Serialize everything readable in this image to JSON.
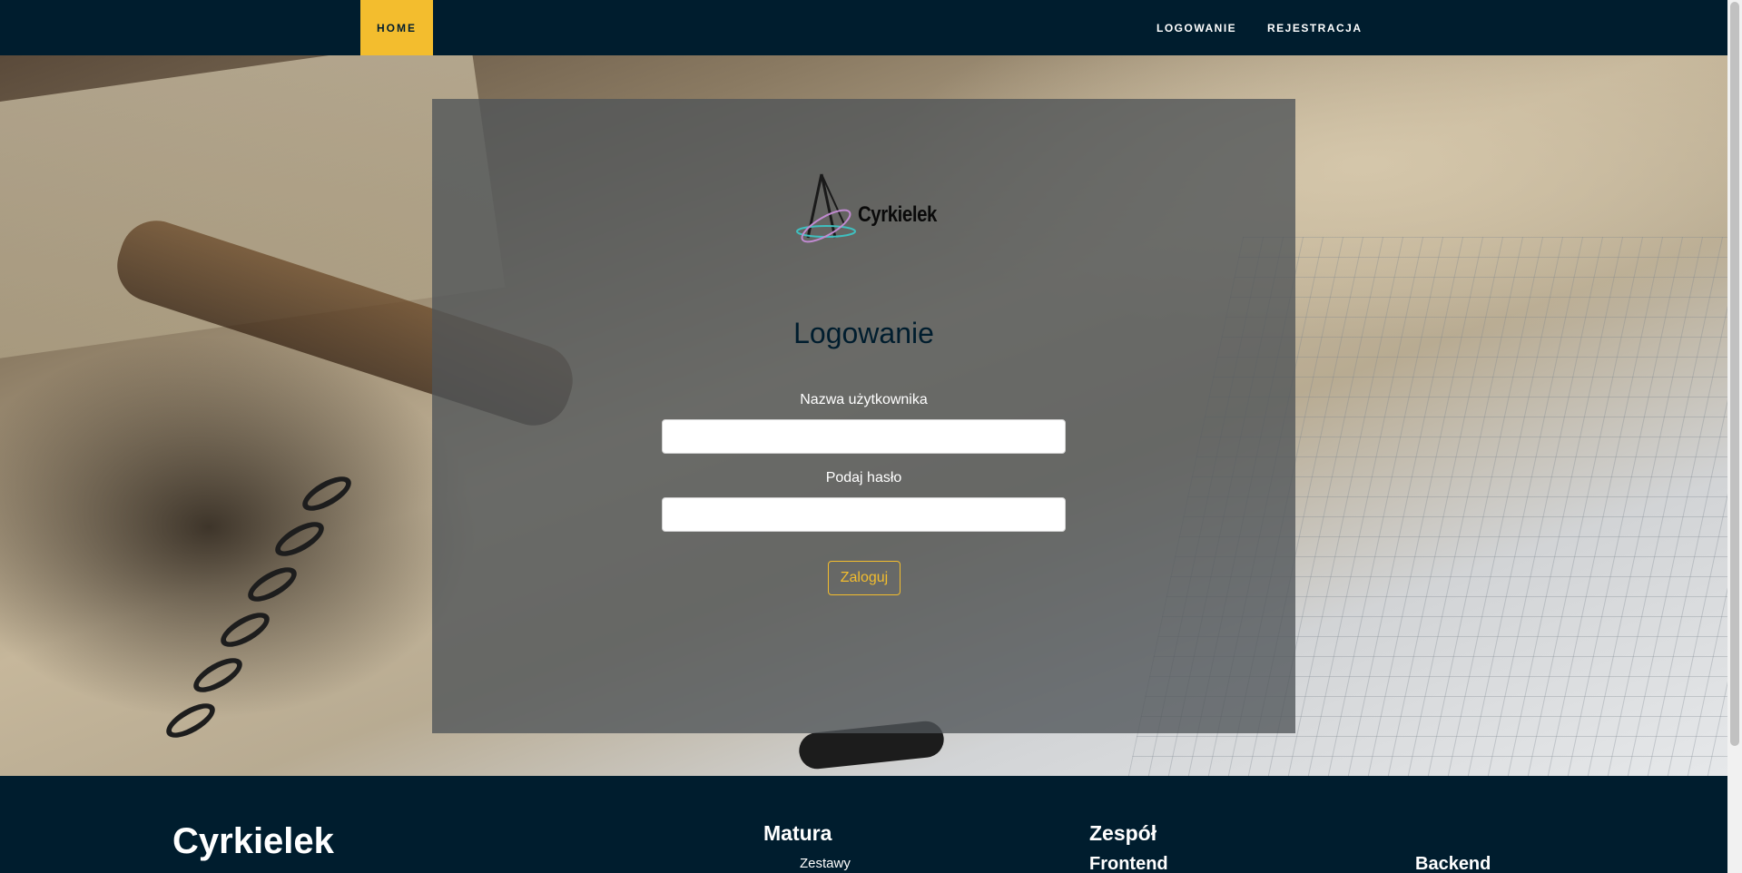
{
  "navbar": {
    "home": "HOME",
    "login": "LOGOWANIE",
    "register": "REJESTRACJA"
  },
  "logo": {
    "text": "Cyrkielek",
    "icon": "compass-logo-icon"
  },
  "form": {
    "title": "Logowanie",
    "username_label": "Nazwa użytkownika",
    "username_value": "",
    "password_label": "Podaj hasło",
    "password_value": "",
    "submit": "Zaloguj"
  },
  "footer": {
    "brand": "Cyrkielek",
    "matura_heading": "Matura",
    "matura_link": "Zestawy",
    "team_heading": "Zespół",
    "frontend": "Frontend",
    "backend": "Backend"
  },
  "colors": {
    "navy": "#001d2e",
    "accent": "#f3bd2e",
    "panel": "#50545 8"
  }
}
